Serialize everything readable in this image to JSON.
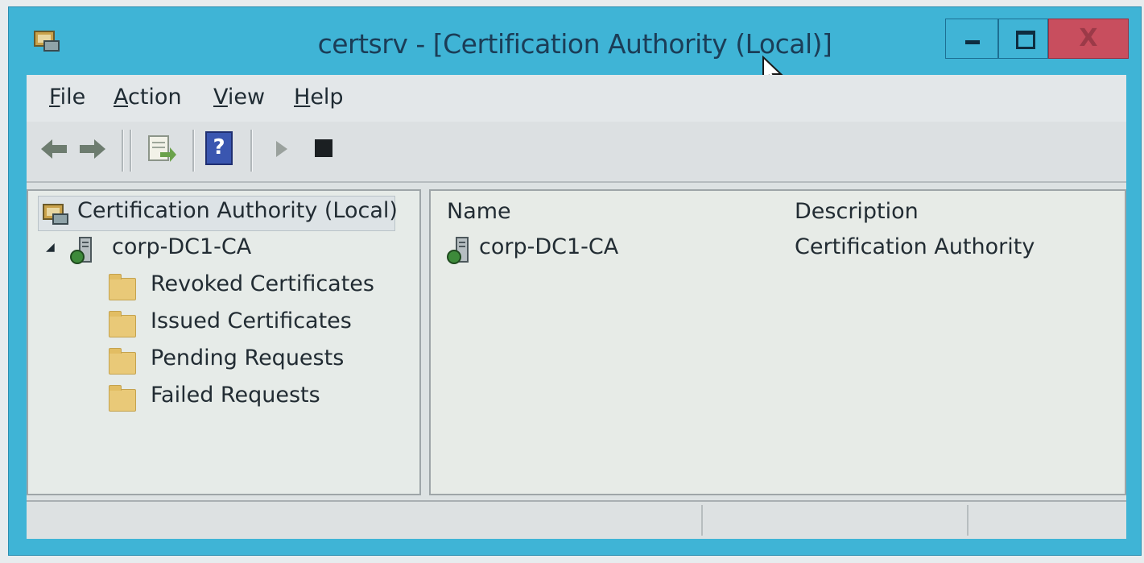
{
  "window": {
    "title": "certsrv - [Certification Authority (Local)]",
    "close_glyph": "X"
  },
  "menu": {
    "file": {
      "u": "F",
      "rest": "ile"
    },
    "action": {
      "u": "A",
      "rest": "ction"
    },
    "view": {
      "u": "V",
      "rest": "iew"
    },
    "help": {
      "u": "H",
      "rest": "elp"
    }
  },
  "toolbar": {
    "help_glyph": "?"
  },
  "tree": {
    "root": "Certification Authority (Local)",
    "ca_node": "corp-DC1-CA",
    "expand_glyph": "◢",
    "children": [
      "Revoked Certificates",
      "Issued Certificates",
      "Pending Requests",
      "Failed Requests"
    ]
  },
  "list": {
    "columns": [
      "Name",
      "Description"
    ],
    "rows": [
      {
        "name": "corp-DC1-CA",
        "description": "Certification Authority"
      }
    ]
  },
  "colors": {
    "frame": "#3fb4d6",
    "close_button": "#c84e5e",
    "client": "#dde2e3"
  }
}
